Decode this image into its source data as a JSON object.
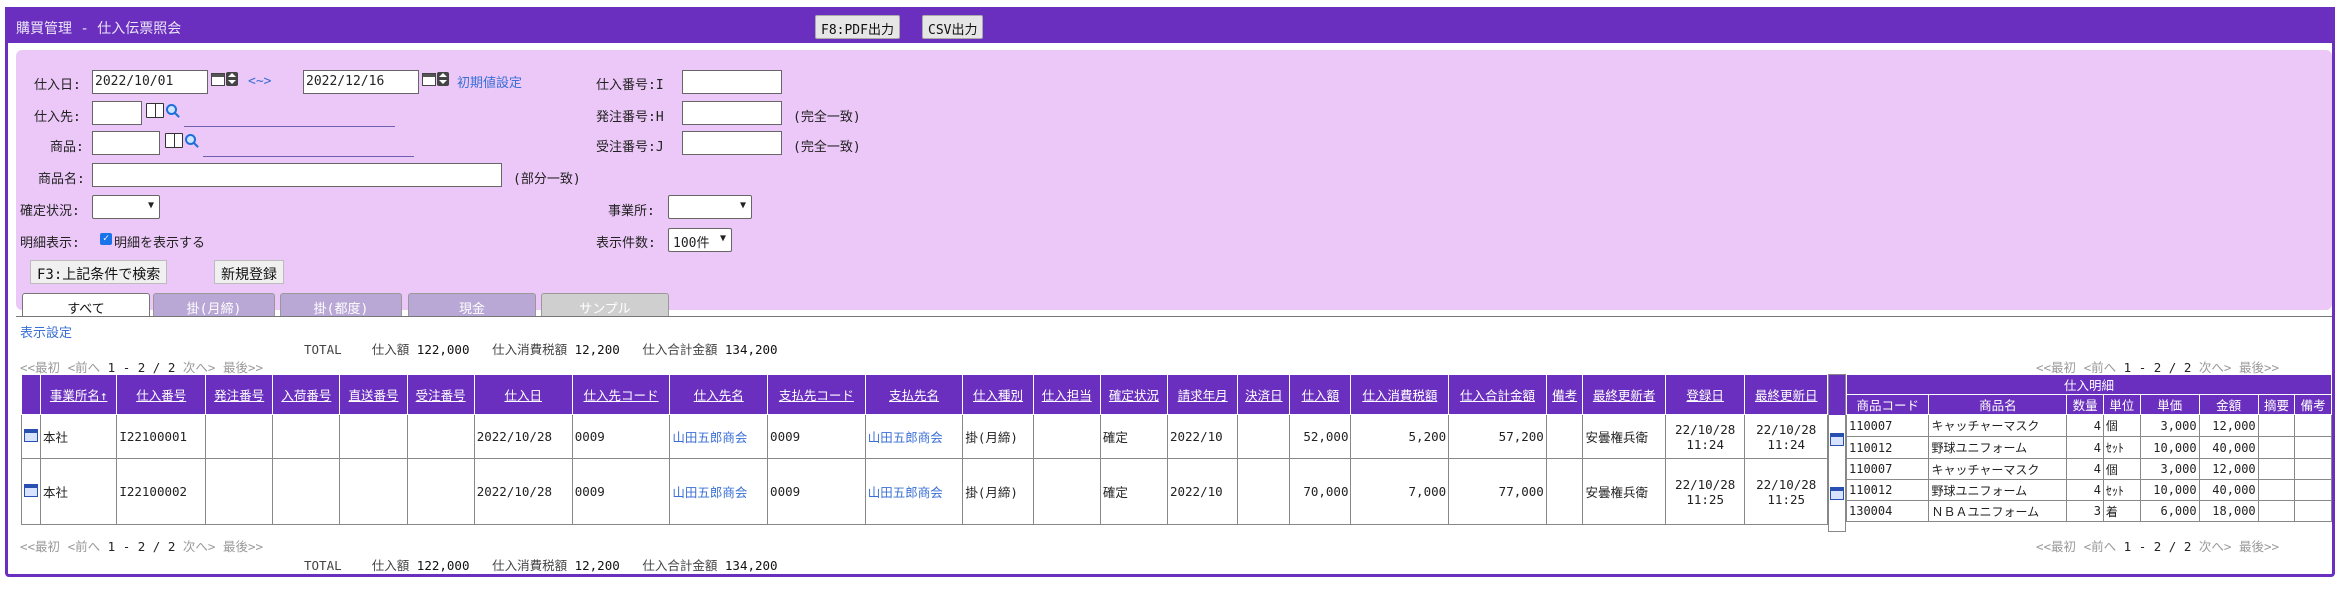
{
  "app": {
    "title": "購買管理 - 仕入伝票照会"
  },
  "toolbar": {
    "pdf_label": "F8:PDF出力",
    "csv_label": "CSV出力"
  },
  "search": {
    "purchase_date_label": "仕入日:",
    "date_from": "2022/10/01",
    "range_sep": "<~>",
    "date_to": "2022/12/16",
    "init_link": "初期値設定",
    "supplier_label": "仕入先:",
    "product_label": "商品:",
    "product_name_label": "商品名:",
    "partial_match": "(部分一致)",
    "status_label": "確定状況:",
    "detail_display_label": "明細表示:",
    "detail_checkbox_label": "明細を表示する",
    "purchase_no_label": "仕入番号:I",
    "order_no_label": "発注番号:H",
    "receive_order_no_label": "受注番号:J",
    "exact_match": "(完全一致)",
    "office_label": "事業所:",
    "count_label": "表示件数:",
    "count_value": "100件",
    "search_button": "F3:上記条件で検索",
    "new_button": "新規登録"
  },
  "tabs": [
    "すべて",
    "掛(月締)",
    "掛(都度)",
    "現金",
    "サンプル"
  ],
  "display_settings": "表示設定",
  "totals": {
    "label": "TOTAL",
    "amount_label": "仕入額",
    "amount": "122,000",
    "tax_label": "仕入消費税額",
    "tax": "12,200",
    "total_label": "仕入合計金額",
    "total": "134,200"
  },
  "pager": {
    "first": "<<最初",
    "prev": "<前へ",
    "range": "1 - 2 / 2",
    "next": "次へ>",
    "last": "最後>>"
  },
  "columns": [
    "事業所名↑",
    "仕入番号",
    "発注番号",
    "入荷番号",
    "直送番号",
    "受注番号",
    "仕入日",
    "仕入先コード",
    "仕入先名",
    "支払先コード",
    "支払先名",
    "仕入種別",
    "仕入担当",
    "確定状況",
    "請求年月",
    "決済日",
    "仕入額",
    "仕入消費税額",
    "仕入合計金額",
    "備考",
    "最終更新者",
    "登録日",
    "最終更新日"
  ],
  "rows": [
    {
      "office": "本社",
      "purchase_no": "I22100001",
      "order_no": "",
      "arrival_no": "",
      "direct_no": "",
      "receive_no": "",
      "date": "2022/10/28",
      "supplier_code": "0009",
      "supplier_name": "山田五郎商会",
      "payee_code": "0009",
      "payee_name": "山田五郎商会",
      "type": "掛(月締)",
      "staff": "",
      "status": "確定",
      "billing_month": "2022/10",
      "settle_date": "",
      "amount": "52,000",
      "tax": "5,200",
      "total": "57,200",
      "note": "",
      "updater": "安曇権兵衛",
      "reg_date": "22/10/28",
      "reg_time": "11:24",
      "upd_date": "22/10/28",
      "upd_time": "11:24"
    },
    {
      "office": "本社",
      "purchase_no": "I22100002",
      "order_no": "",
      "arrival_no": "",
      "direct_no": "",
      "receive_no": "",
      "date": "2022/10/28",
      "supplier_code": "0009",
      "supplier_name": "山田五郎商会",
      "payee_code": "0009",
      "payee_name": "山田五郎商会",
      "type": "掛(月締)",
      "staff": "",
      "status": "確定",
      "billing_month": "2022/10",
      "settle_date": "",
      "amount": "70,000",
      "tax": "7,000",
      "total": "77,000",
      "note": "",
      "updater": "安曇権兵衛",
      "reg_date": "22/10/28",
      "reg_time": "11:25",
      "upd_date": "22/10/28",
      "upd_time": "11:25"
    }
  ],
  "detail": {
    "title": "仕入明細",
    "columns": [
      "商品コード",
      "商品名",
      "数量",
      "単位",
      "単価",
      "金額",
      "摘要",
      "備考"
    ],
    "lines": [
      {
        "code": "110007",
        "name": "キャッチャーマスク",
        "qty": "4",
        "unit": "個",
        "price": "3,000",
        "amount": "12,000",
        "summary": "",
        "note": ""
      },
      {
        "code": "110012",
        "name": "野球ユニフォーム",
        "qty": "4",
        "unit": "ｾｯﾄ",
        "price": "10,000",
        "amount": "40,000",
        "summary": "",
        "note": ""
      },
      {
        "code": "110007",
        "name": "キャッチャーマスク",
        "qty": "4",
        "unit": "個",
        "price": "3,000",
        "amount": "12,000",
        "summary": "",
        "note": ""
      },
      {
        "code": "110012",
        "name": "野球ユニフォーム",
        "qty": "4",
        "unit": "ｾｯﾄ",
        "price": "10,000",
        "amount": "40,000",
        "summary": "",
        "note": ""
      },
      {
        "code": "130004",
        "name": "ＮＢＡユニフォーム",
        "qty": "3",
        "unit": "着",
        "price": "6,000",
        "amount": "18,000",
        "summary": "",
        "note": ""
      }
    ]
  }
}
